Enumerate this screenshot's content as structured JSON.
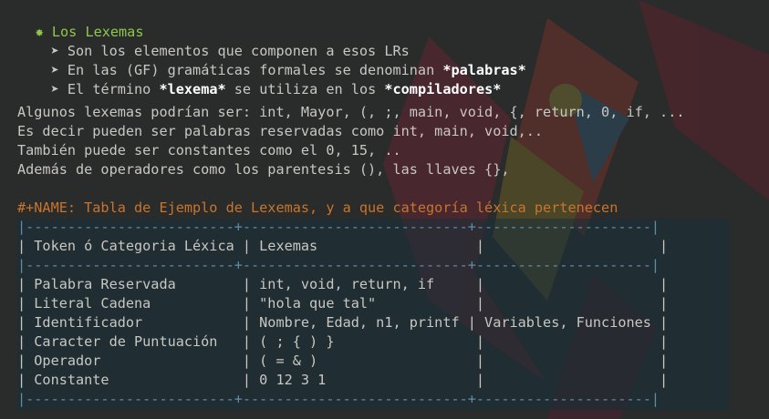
{
  "heading": {
    "bullet": "✸",
    "title": "Los Lexemas"
  },
  "points": [
    {
      "arrow": "➤",
      "text_a": "Son los elementos que componen a esos LRs",
      "bold": "",
      "text_b": ""
    },
    {
      "arrow": "➤",
      "text_a": "En las (GF) gramáticas formales se denominan ",
      "bold": "*palabras*",
      "text_b": ""
    },
    {
      "arrow": "➤",
      "text_a": "El término ",
      "bold": "*lexema*",
      "text_b": " se utiliza en los ",
      "bold2": "*compiladores*"
    }
  ],
  "paragraph": [
    "Algunos lexemas podrían ser: int, Mayor, (, ;, main, void, {, return, 0, if, ...",
    "Es decir pueden ser palabras reservadas como int, main, void,..",
    "También puede ser constantes como el 0, 15, ..",
    "Además de operadores como los parentesis (), las llaves {},"
  ],
  "table_name": "#+NAME: Tabla de Ejemplo de Lexemas, y a que categoría léxica pertenecen",
  "table_lines": [
    "|-------------------------+---------------------------+---------------------|",
    "| Token ó Categoria Léxica | Lexemas                   |                     |",
    "|-------------------------+---------------------------+---------------------|",
    "| Palabra Reservada        | int, void, return, if     |                     |",
    "| Literal Cadena           | \"hola que tal\"            |                     |",
    "| Identificador            | Nombre, Edad, n1, printf | Variables, Funciones |",
    "| Caracter de Puntuación   | ( ; { ) }                 |                     |",
    "| Operador                 | ( = & )                   |                     |",
    "| Constante                | 0 12 3 1                  |                     |",
    "|-------------------------+---------------------------+---------------------|"
  ],
  "colors": {
    "background": "#2a2b2b",
    "heading": "#8fc84a",
    "meta": "#c8752d",
    "text": "#c9c7c2"
  }
}
